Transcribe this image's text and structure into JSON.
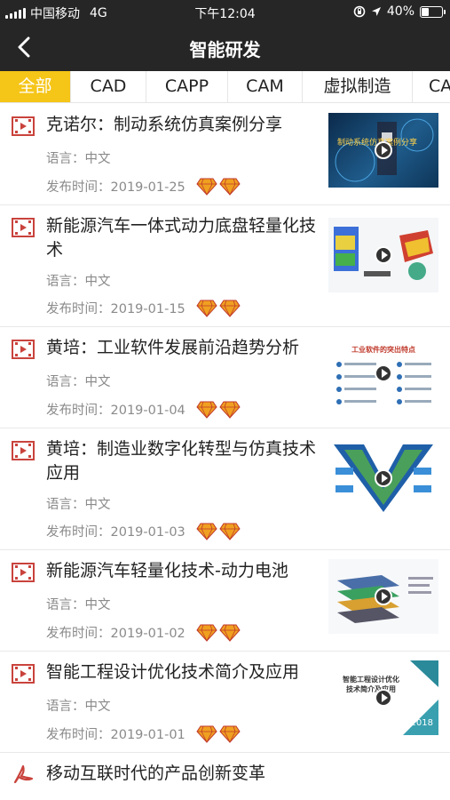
{
  "status": {
    "carrier": "中国移动",
    "network": "4G",
    "time": "下午12:04",
    "battery": "40%",
    "battery_level": 0.4
  },
  "nav": {
    "title": "智能研发"
  },
  "tabs": [
    "全部",
    "CAD",
    "CAPP",
    "CAM",
    "虚拟制造",
    "CA"
  ],
  "items": [
    {
      "title": "克诺尔：制动系统仿真案例分享",
      "lang": "语言：中文",
      "date": "发布时间：2019-01-25",
      "thumb_text": "制动系统仿真案例分享"
    },
    {
      "title": "新能源汽车一体式动力底盘轻量化技术",
      "lang": "语言：中文",
      "date": "发布时间：2019-01-15",
      "thumb_text": ""
    },
    {
      "title": "黄培：工业软件发展前沿趋势分析",
      "lang": "语言：中文",
      "date": "发布时间：2019-01-04",
      "thumb_text": "工业软件的突出特点"
    },
    {
      "title": "黄培：制造业数字化转型与仿真技术应用",
      "lang": "语言：中文",
      "date": "发布时间：2019-01-03",
      "thumb_text": ""
    },
    {
      "title": "新能源汽车轻量化技术-动力电池",
      "lang": "语言：中文",
      "date": "发布时间：2019-01-02",
      "thumb_text": ""
    },
    {
      "title": "智能工程设计优化技术简介及应用",
      "lang": "语言：中文",
      "date": "发布时间：2019-01-01",
      "thumb_text": "智能工程设计优化技术简介及应用",
      "thumb_year": "2018"
    }
  ],
  "last_item": {
    "title": "移动互联时代的产品创新变革"
  },
  "colors": {
    "accent": "#f5c518",
    "bar": "#262626",
    "icon_red": "#c9433c",
    "gem": "#f0a020"
  }
}
